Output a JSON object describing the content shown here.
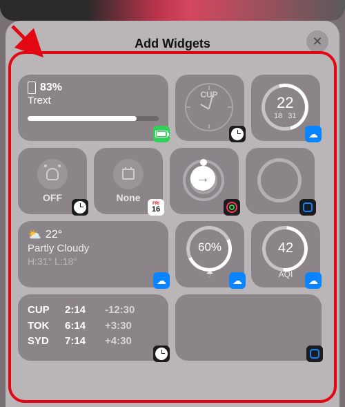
{
  "header": {
    "title": "Add Widgets",
    "close": "✕"
  },
  "battery": {
    "percent": "83%",
    "device": "Trext"
  },
  "clock": {
    "city": "CUP"
  },
  "temp_ring": {
    "current": "22",
    "low": "18",
    "high": "31"
  },
  "alarm": {
    "label": "OFF"
  },
  "calendar": {
    "label": "None",
    "badge_day": "16",
    "badge_top": "FRI"
  },
  "weather": {
    "temp": "22°",
    "condition": "Partly Cloudy",
    "high": "H:31°",
    "low": "L:18°"
  },
  "precip": {
    "value": "60%",
    "icon": "☂"
  },
  "aqi": {
    "value": "42",
    "label": "AQI"
  },
  "world_clocks": [
    {
      "city": "CUP",
      "time": "2:14",
      "offset": "-12:30"
    },
    {
      "city": "TOK",
      "time": "6:14",
      "offset": "+3:30"
    },
    {
      "city": "SYD",
      "time": "7:14",
      "offset": "+4:30"
    }
  ]
}
